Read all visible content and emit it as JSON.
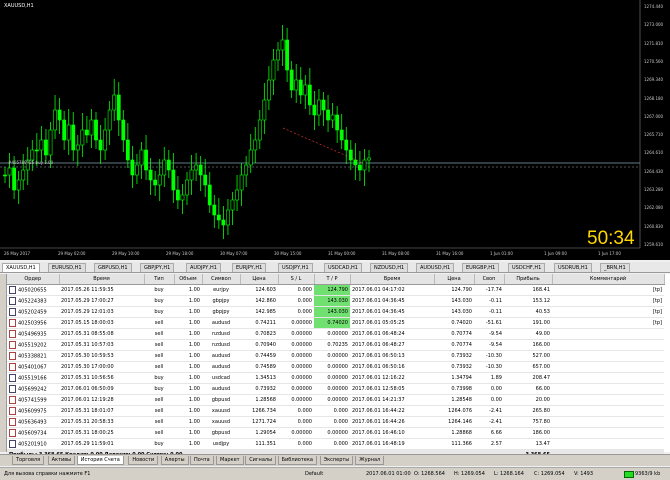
{
  "chart": {
    "title": "XAUUSD,H1",
    "order_label": "#405789926 buy 1.00",
    "clock": "50:34",
    "price_labels": [
      "1274.440",
      "1273.000",
      "1271.810",
      "1270.560",
      "1269.340",
      "1268.180",
      "1267.000",
      "1265.710",
      "1264.610",
      "1264.430",
      "1263.280",
      "1262.080",
      "1260.830",
      "1259.610"
    ],
    "time_labels": [
      "26 May 2017",
      "29 May 02:00",
      "29 May 10:00",
      "29 May 18:00",
      "30 May 07:00",
      "30 May 15:00",
      "31 May 00:00",
      "31 May 08:00",
      "31 May 16:00",
      "1 Jun 01:00",
      "1 Jun 09:00",
      "1 Jun 17:00"
    ]
  },
  "symbol_tabs": [
    "XAUUSD,H1",
    "EURUSD,H1",
    "GBPUSD,H1",
    "GBPJPY,H1",
    "AUDJPY,H1",
    "EURJPY,H1",
    "USDJPY,H1",
    "USDCAD,H1",
    "NZDUSD,H1",
    "AUDUSD,H1",
    "EURGBP,H1",
    "USDCHF,H1",
    "USDRUB,H1",
    "_BRN,H1"
  ],
  "table": {
    "headers": [
      "Ордер",
      "Время",
      "Тип",
      "Объем",
      "Символ",
      "Цена",
      "S / L",
      "T / P",
      "Время",
      "Цена",
      "Своп",
      "Прибыль",
      "Комментарий"
    ],
    "rows": [
      [
        "405020655",
        "2017.05.26 11:59:35",
        "buy",
        "1.00",
        "eurjpy",
        "124.603",
        "0.000",
        "124.790",
        "2017.06.01 04:17:02",
        "124.790",
        "-17.74",
        "168.41",
        "[tp]"
      ],
      [
        "405224383",
        "2017.05.29 17:00:27",
        "buy",
        "1.00",
        "gbpjpy",
        "142.860",
        "0.000",
        "143.030",
        "2017.06.01 04:36:45",
        "143.030",
        "-0.11",
        "153.12",
        "[tp]"
      ],
      [
        "405202459",
        "2017.05.29 12:01:03",
        "buy",
        "1.00",
        "gbpjpy",
        "142.985",
        "0.000",
        "143.030",
        "2017.06.01 04:36:45",
        "143.030",
        "-0.11",
        "40.53",
        "[tp]"
      ],
      [
        "402503956",
        "2017.05.15 18:00:03",
        "sell",
        "1.00",
        "audusd",
        "0.74211",
        "0.00000",
        "0.74020",
        "2017.06.01 05:05:25",
        "0.74020",
        "-51.61",
        "191.00",
        "[tp]"
      ],
      [
        "405496935",
        "2017.05.31 08:55:08",
        "sell",
        "1.00",
        "nzdusd",
        "0.70823",
        "0.00000",
        "0.00000",
        "2017.06.01 06:48:24",
        "0.70774",
        "-9.54",
        "49.00",
        ""
      ],
      [
        "405519202",
        "2017.05.31 10:57:03",
        "sell",
        "1.00",
        "nzdusd",
        "0.70940",
        "0.00000",
        "0.70235",
        "2017.06.01 06:48:27",
        "0.70774",
        "-9.54",
        "166.00",
        ""
      ],
      [
        "405338821",
        "2017.05.30 10:59:53",
        "sell",
        "1.00",
        "audusd",
        "0.74459",
        "0.00000",
        "0.00000",
        "2017.06.01 06:50:13",
        "0.73932",
        "-10.30",
        "527.00",
        ""
      ],
      [
        "405401067",
        "2017.05.30 17:00:00",
        "sell",
        "1.00",
        "audusd",
        "0.74589",
        "0.00000",
        "0.00000",
        "2017.06.01 06:50:16",
        "0.73932",
        "-10.30",
        "657.00",
        ""
      ],
      [
        "405519166",
        "2017.05.31 10:56:56",
        "buy",
        "1.00",
        "usdcad",
        "1.34513",
        "0.00000",
        "0.00000",
        "2017.06.01 12:16:22",
        "1.34794",
        "1.89",
        "208.47",
        ""
      ],
      [
        "405699242",
        "2017.06.01 06:50:09",
        "buy",
        "1.00",
        "audusd",
        "0.73932",
        "0.00000",
        "0.00000",
        "2017.06.01 12:58:05",
        "0.73998",
        "0.00",
        "66.00",
        ""
      ],
      [
        "405741599",
        "2017.06.01 12:19:28",
        "sell",
        "1.00",
        "gbpusd",
        "1.28568",
        "0.00000",
        "0.00000",
        "2017.06.01 14:21:37",
        "1.28548",
        "0.00",
        "20.00",
        ""
      ],
      [
        "405609975",
        "2017.05.31 18:01:07",
        "sell",
        "1.00",
        "xauusd",
        "1266.734",
        "0.000",
        "0.000",
        "2017.06.01 16:44:22",
        "1264.076",
        "-2.41",
        "265.80",
        ""
      ],
      [
        "405636493",
        "2017.05.31 20:58:33",
        "sell",
        "1.00",
        "xauusd",
        "1271.724",
        "0.000",
        "0.000",
        "2017.06.01 16:44:26",
        "1264.146",
        "-2.41",
        "757.80",
        ""
      ],
      [
        "405609734",
        "2017.05.31 18:00:25",
        "sell",
        "1.00",
        "gbpusd",
        "1.29054",
        "0.00000",
        "0.00000",
        "2017.06.01 16:46:10",
        "1.28868",
        "6.66",
        "186.00",
        ""
      ],
      [
        "405201910",
        "2017.05.29 11:59:01",
        "buy",
        "1.00",
        "usdjpy",
        "111.351",
        "0.000",
        "0.000",
        "2017.06.01 16:48:19",
        "111.366",
        "2.57",
        "13.47",
        ""
      ]
    ],
    "total_left": "Прибыль: 3 368.65 Кредит: 0.00 Депозит: 0.00 Снятие: 0.00",
    "total_right": "3 368.65"
  },
  "bottom_tabs": [
    "Торговля",
    "Активы",
    "История Счета",
    "Новости",
    "Алерты",
    "Почта",
    "Маркет",
    "Сигналы",
    "Библиотека",
    "Эксперты",
    "Журнал"
  ],
  "status": {
    "help": "Для вызова справки нажмите F1",
    "profile": "Default",
    "time": "2017.06.01 01:00",
    "open": "O: 1268.564",
    "high": "H: 1269.054",
    "low": "L: 1268.164",
    "close": "C: 1269.054",
    "volume": "V: 1493",
    "traffic": "9363/9 kb"
  },
  "colors": {
    "up": "#00ff00",
    "tp": "#70e070",
    "clock": "#ffd700"
  }
}
